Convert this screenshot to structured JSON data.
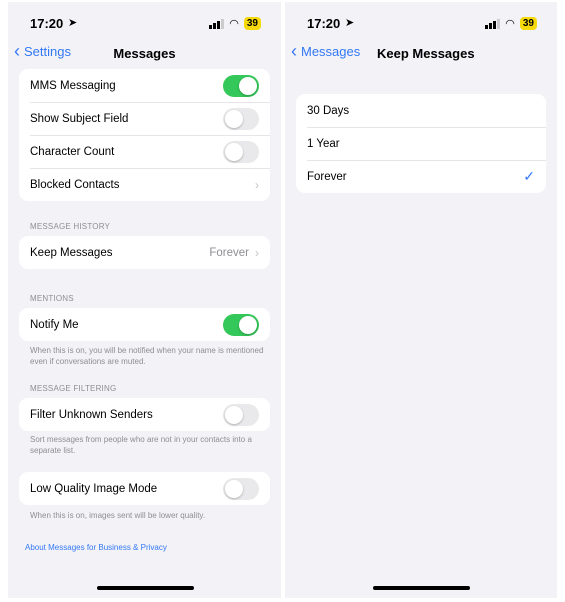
{
  "status": {
    "time": "17:20",
    "battery": "39"
  },
  "left": {
    "back_label": "Settings",
    "title": "Messages",
    "group1": [
      {
        "label": "MMS Messaging",
        "type": "toggle",
        "on": true
      },
      {
        "label": "Show Subject Field",
        "type": "toggle",
        "on": false
      },
      {
        "label": "Character Count",
        "type": "toggle",
        "on": false
      },
      {
        "label": "Blocked Contacts",
        "type": "chevron"
      }
    ],
    "history_header": "MESSAGE HISTORY",
    "keep_messages": {
      "label": "Keep Messages",
      "value": "Forever"
    },
    "mentions_header": "MENTIONS",
    "notify_me": {
      "label": "Notify Me",
      "on": true
    },
    "notify_footer": "When this is on, you will be notified when your name is mentioned even if conversations are muted.",
    "filtering_header": "MESSAGE FILTERING",
    "filter_unknown": {
      "label": "Filter Unknown Senders",
      "on": false
    },
    "filter_footer": "Sort messages from people who are not in your contacts into a separate list.",
    "low_quality": {
      "label": "Low Quality Image Mode",
      "on": false
    },
    "low_quality_footer": "When this is on, images sent will be lower quality.",
    "about_link": "About Messages for Business & Privacy"
  },
  "right": {
    "back_label": "Messages",
    "title": "Keep Messages",
    "options": [
      {
        "label": "30 Days",
        "selected": false
      },
      {
        "label": "1 Year",
        "selected": false
      },
      {
        "label": "Forever",
        "selected": true
      }
    ]
  },
  "colors": {
    "accent": "#3478f6",
    "toggle_on": "#34c759",
    "background": "#f2f2f7"
  }
}
